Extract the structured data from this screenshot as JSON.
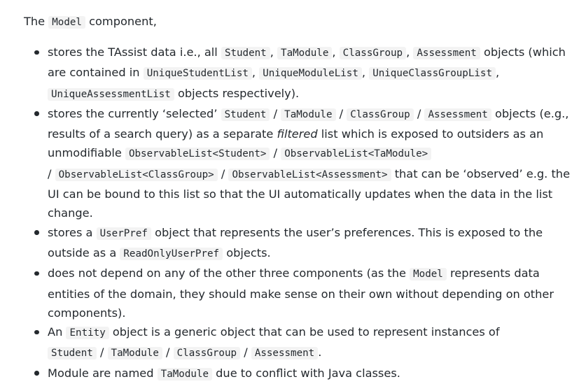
{
  "intro": {
    "pre": "The ",
    "code": "Model",
    "post": " component,"
  },
  "items": [
    {
      "t0": "stores the TAssist data i.e., all ",
      "c0": "Student",
      "t1": ", ",
      "c1": "TaModule",
      "t2": ", ",
      "c2": "ClassGroup",
      "t3": ", ",
      "c3": "Assessment",
      "t4": " objects (which are contained in ",
      "c4": "UniqueStudentList",
      "t5": ", ",
      "c5": "UniqueModuleList",
      "t6": ", ",
      "c6": "UniqueClassGroupList",
      "t7": ", ",
      "c7": "UniqueAssessmentList",
      "t8": " objects respectively)."
    },
    {
      "t0": "stores the currently ‘selected’ ",
      "c0": "Student",
      "t1": " / ",
      "c1": "TaModule",
      "t2": " / ",
      "c2": "ClassGroup",
      "t3": " / ",
      "c3": "Assessment",
      "t4": " objects (e.g., results of a search query) as a separate ",
      "em": "filtered",
      "t5": " list which is exposed to outsiders as an unmodifiable ",
      "c4": "ObservableList<Student>",
      "t6": " / ",
      "c5": "ObservableList<TaModule>",
      "t7": " / ",
      "c6": "ObservableList<ClassGroup>",
      "t8": " / ",
      "c7": "ObservableList<Assessment>",
      "t9": " that can be ‘observed’ e.g. the UI can be bound to this list so that the UI automatically updates when the data in the list change."
    },
    {
      "t0": "stores a ",
      "c0": "UserPref",
      "t1": " object that represents the user’s preferences. This is exposed to the outside as a ",
      "c1": "ReadOnlyUserPref",
      "t2": " objects."
    },
    {
      "t0": "does not depend on any of the other three components (as the ",
      "c0": "Model",
      "t1": " represents data entities of the domain, they should make sense on their own without depending on other components)."
    },
    {
      "t0": "An ",
      "c0": "Entity",
      "t1": " object is a generic object that can be used to represent instances of ",
      "c1": "Student",
      "t2": " / ",
      "c2": "TaModule",
      "t3": " / ",
      "c3": "ClassGroup",
      "t4": " / ",
      "c4": "Assessment",
      "t5": "."
    },
    {
      "t0": "Module are named ",
      "c0": "TaModule",
      "t1": " due to conflict with Java classes."
    }
  ]
}
